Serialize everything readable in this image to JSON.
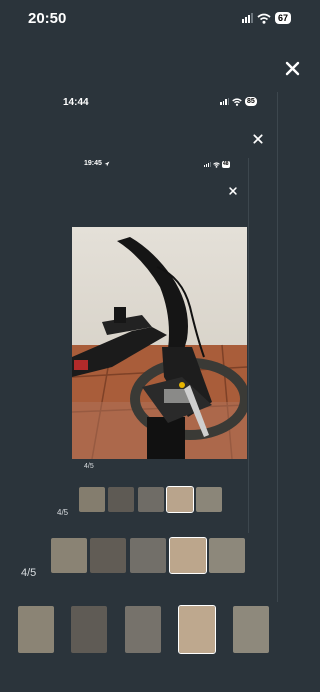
{
  "level1": {
    "status": {
      "time": "20:50",
      "battery": "67"
    },
    "counter": "4/5"
  },
  "level2": {
    "status": {
      "time": "14:44",
      "battery": "85"
    },
    "counter": "4/5"
  },
  "level3": {
    "status": {
      "time": "19:45",
      "battery": "48"
    },
    "counter": "4/5"
  },
  "icons": {
    "close": "close-icon",
    "wifi": "wifi-icon",
    "signal": "signal-icon",
    "battery": "battery-icon",
    "location": "location-arrow-icon"
  },
  "gallery": {
    "item_count": 5,
    "selected_index": 3
  }
}
